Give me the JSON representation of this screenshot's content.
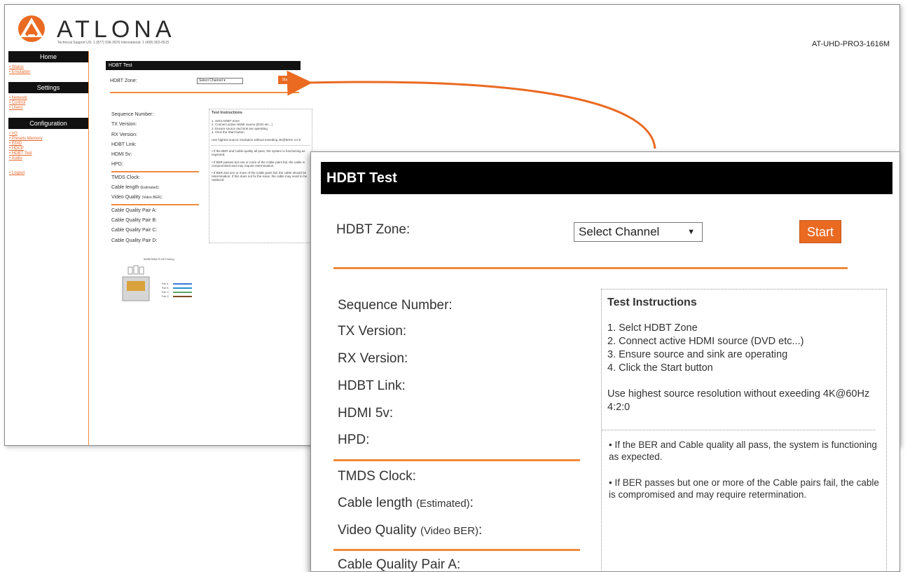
{
  "brand": {
    "name": "ATLONA",
    "support_line": "Technical Support   US: 1 (877) 536-3976   International: 1 (408) 962-0515",
    "model": "AT-UHD-PRO3-1616M",
    "accent": "#ea6a22"
  },
  "sidebar": {
    "sections": [
      {
        "title": "Home",
        "items": [
          "Status",
          "Emulation"
        ]
      },
      {
        "title": "Settings",
        "items": [
          "Network",
          "Control",
          "Users"
        ]
      },
      {
        "title": "Configuration",
        "items": [
          "I/O",
          "Presets Memory",
          "EDID",
          "HDCP",
          "HDBT Test",
          "Audio"
        ]
      }
    ],
    "logout": "Logout"
  },
  "page": {
    "title": "HDBT Test",
    "zone_label": "HDBT Zone:",
    "zone_select": "Select Channel",
    "start_label": "Start",
    "fields_group1": [
      "Sequence Number:",
      "TX Version:",
      "RX Version:",
      "HDBT Link:",
      "HDMI 5v:",
      "HPD:"
    ],
    "fields_group2": [
      {
        "main": "TMDS Clock:",
        "small": ""
      },
      {
        "main": "Cable length ",
        "small": "(Estimated)",
        "tail": ":"
      },
      {
        "main": "Video Quality ",
        "small": "(Video BER)",
        "tail": ":"
      }
    ],
    "fields_group3": [
      "Cable Quality Pair A:",
      "Cable Quality Pair B:",
      "Cable Quality Pair C:",
      "Cable Quality Pair D:"
    ],
    "rj45_title": "568B/568A RJ45 Pairing",
    "rj45_pairs": [
      "Pair A",
      "Pair B",
      "Pair C",
      "Pair D"
    ],
    "instructions": {
      "title": "Test Instructions",
      "steps": [
        "1. Selct HDBT Zone",
        "2. Connect active HDMI source (DVD etc...)",
        "3. Ensure source and sink are operating",
        "4. Click the Start button"
      ],
      "note": "Use highest source resolution without exeeding 4K@60Hz 4:2:0",
      "bullets": [
        "• If the BER and Cable quality all pass, the system is functioning as expected.",
        "• If BER passes but one or more of the Cable pairs fail, the cable is compromised and may require retermination.",
        "• If BER and one or more of the Cable pairs fail, the cable should be retermination. If this does not fix the issue, the cable may need to be replaced."
      ]
    },
    "zoom_partial_label": "Cable Quality Pair A:"
  }
}
